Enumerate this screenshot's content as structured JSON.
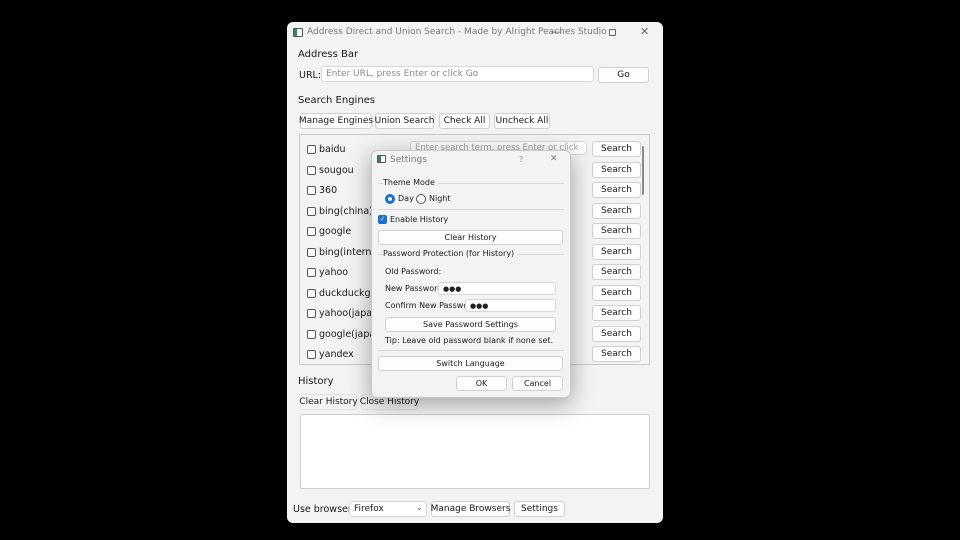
{
  "window": {
    "title": "Address Direct and Union Search - Made by Alright Peaches Studio"
  },
  "address_bar": {
    "heading": "Address Bar",
    "url_label": "URL:",
    "url_placeholder": "Enter URL, press Enter or click Go",
    "go_label": "Go"
  },
  "search_engines": {
    "heading": "Search Engines",
    "buttons": [
      "Manage Engines",
      "Union Search",
      "Check All",
      "Uncheck All"
    ],
    "search_placeholder": "Enter search term, press Enter or click",
    "search_label": "Search",
    "engines": [
      "baidu",
      "sougou",
      "360",
      "bing(china)",
      "google",
      "bing(international)",
      "yahoo",
      "duckduckgo",
      "yahoo(japan)",
      "google(japan)",
      "yandex"
    ]
  },
  "history": {
    "heading": "History",
    "clear_label": "Clear History",
    "close_label": "Close History"
  },
  "footer": {
    "browser_label": "Use browser:",
    "browser_value": "Firefox",
    "manage_browsers_label": "Manage Browsers",
    "settings_label": "Settings"
  },
  "settings_dialog": {
    "title": "Settings",
    "help_glyph": "?",
    "close_glyph": "✕",
    "theme_heading": "Theme Mode",
    "theme_day": "Day",
    "theme_night": "Night",
    "theme_selected": "Day",
    "enable_history_label": "Enable History",
    "enable_history_checked": true,
    "clear_history_label": "Clear History",
    "password_heading": "Password Protection (for History)",
    "old_password_label": "Old Password:",
    "new_password_label": "New Password:",
    "new_password_value": "●●●",
    "confirm_password_label": "Confirm New Password:",
    "confirm_password_value": "●●●",
    "save_password_label": "Save Password Settings",
    "tip": "Tip: Leave old password blank if none set.",
    "switch_language_label": "Switch Language",
    "ok_label": "OK",
    "cancel_label": "Cancel"
  },
  "colors": {
    "accent": "#1a6fd0",
    "window_bg": "#f3f3f3",
    "backdrop": "#000000"
  }
}
